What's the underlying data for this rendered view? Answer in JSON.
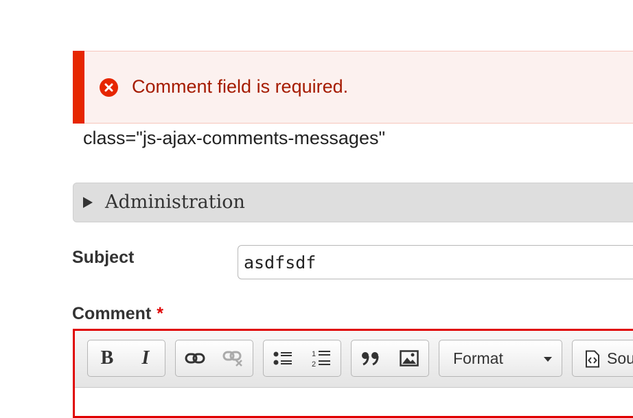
{
  "messages": {
    "error_text": "Comment field is required.",
    "class_note": "class=\"js-ajax-comments-messages\"",
    "error_icon": "error-x-circle-icon",
    "error_color": "#e62600"
  },
  "details": {
    "label": "Administration"
  },
  "form": {
    "subject_label": "Subject",
    "subject_value": "asdfsdf",
    "comment_label": "Comment",
    "required_mark": "*"
  },
  "toolbar": {
    "bold_label": "B",
    "italic_label": "I",
    "format_label": "Format",
    "source_label": "Sou",
    "icons": [
      "bold-icon",
      "italic-icon",
      "link-icon",
      "unlink-icon",
      "bulleted-list-icon",
      "numbered-list-icon",
      "blockquote-icon",
      "image-icon",
      "source-icon"
    ]
  }
}
